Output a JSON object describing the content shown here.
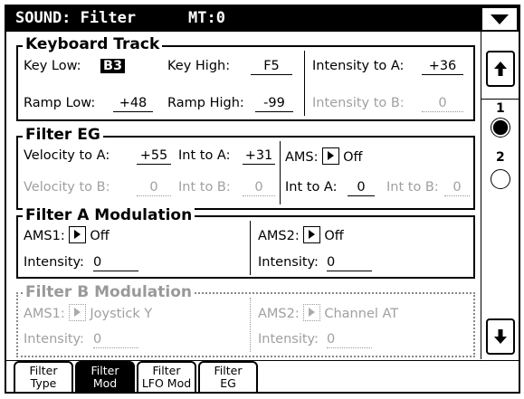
{
  "header": {
    "title": "SOUND: Filter",
    "mt": "MT:0"
  },
  "icons": {
    "menu": "menu-triangle-down-icon",
    "up": "scroll-up-arrow-icon",
    "down": "scroll-down-arrow-icon",
    "popup": "popup-triangle-icon"
  },
  "keyboard_track": {
    "title": "Keyboard Track",
    "key_low_label": "Key Low:",
    "key_low_value": "B3",
    "key_high_label": "Key High:",
    "key_high_value": "F5",
    "intensity_a_label": "Intensity to A:",
    "intensity_a_value": "+36",
    "ramp_low_label": "Ramp Low:",
    "ramp_low_value": "+48",
    "ramp_high_label": "Ramp High:",
    "ramp_high_value": "-99",
    "intensity_b_label": "Intensity to B:",
    "intensity_b_value": "0"
  },
  "filter_eg": {
    "title": "Filter EG",
    "vel_a_label": "Velocity to A:",
    "vel_a_value": "+55",
    "int_a_label": "Int to A:",
    "int_a_value": "+31",
    "ams_label": "AMS:",
    "ams_value": "Off",
    "vel_b_label": "Velocity to B:",
    "vel_b_value": "0",
    "int_b_label": "Int to B:",
    "int_b_value": "0",
    "ams_int_a_label": "Int to A:",
    "ams_int_a_value": "0",
    "ams_int_b_label": "Int to B:",
    "ams_int_b_value": "0"
  },
  "filter_a_mod": {
    "title": "Filter A Modulation",
    "ams1_label": "AMS1:",
    "ams1_value": "Off",
    "ams2_label": "AMS2:",
    "ams2_value": "Off",
    "int1_label": "Intensity:",
    "int1_value": "0",
    "int2_label": "Intensity:",
    "int2_value": "0"
  },
  "filter_b_mod": {
    "title": "Filter B Modulation",
    "ams1_label": "AMS1:",
    "ams1_value": "Joystick Y",
    "ams2_label": "AMS2:",
    "ams2_value": "Channel AT",
    "int1_label": "Intensity:",
    "int1_value": "0",
    "int2_label": "Intensity:",
    "int2_value": "0"
  },
  "page_select": {
    "page1": "1",
    "page2": "2",
    "selected_page": 1
  },
  "tabs": [
    {
      "line1": "Filter",
      "line2": "Type",
      "active": false
    },
    {
      "line1": "Filter",
      "line2": "Mod",
      "active": true
    },
    {
      "line1": "Filter",
      "line2": "LFO Mod",
      "active": false
    },
    {
      "line1": "Filter",
      "line2": "EG",
      "active": false
    }
  ]
}
